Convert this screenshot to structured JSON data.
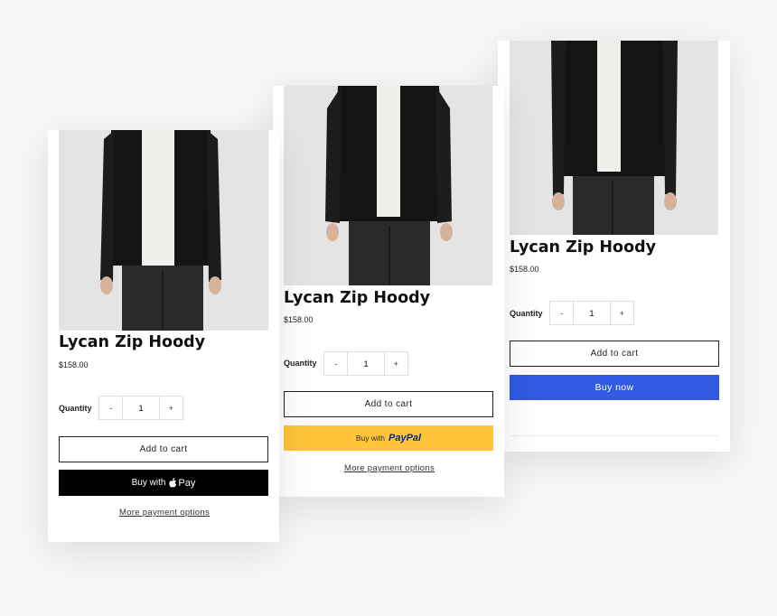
{
  "cards": [
    {
      "title": "Lycan Zip Hoody",
      "price": "$158.00",
      "quantity_label": "Quantity",
      "quantity_value": "1",
      "minus": "-",
      "plus": "+",
      "add_to_cart": "Add to cart",
      "buy_prefix": "Buy with",
      "buy_brand": "Pay",
      "buy_brand_icon": "apple-icon",
      "more_options": "More payment options",
      "buy_color": "#000000"
    },
    {
      "title": "Lycan Zip Hoody",
      "price": "$158.00",
      "quantity_label": "Quantity",
      "quantity_value": "1",
      "minus": "-",
      "plus": "+",
      "add_to_cart": "Add to cart",
      "buy_prefix": "Buy with",
      "buy_brand": "PayPal",
      "more_options": "More payment options",
      "buy_color": "#ffc439"
    },
    {
      "title": "Lycan Zip Hoody",
      "price": "$158.00",
      "quantity_label": "Quantity",
      "quantity_value": "1",
      "minus": "-",
      "plus": "+",
      "add_to_cart": "Add to cart",
      "buy_now": "Buy now",
      "buy_color": "#3159e2"
    }
  ]
}
